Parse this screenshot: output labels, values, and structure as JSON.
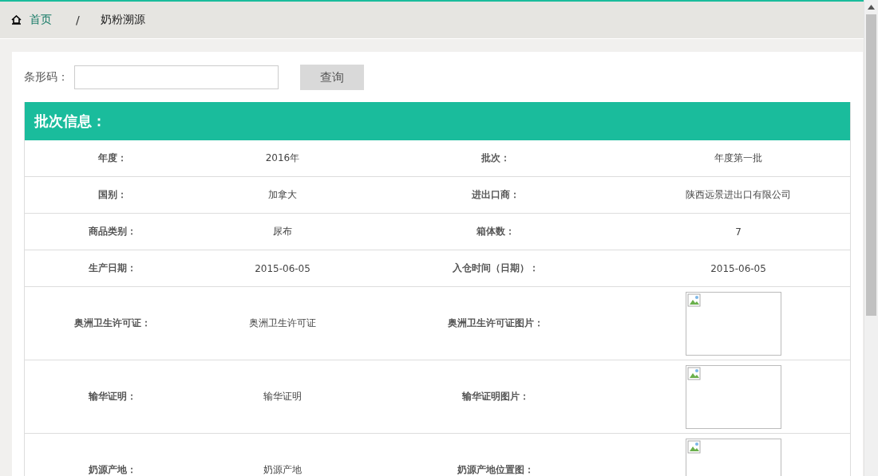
{
  "breadcrumb": {
    "home": "首页",
    "separator": "/",
    "current": "奶粉溯源"
  },
  "search": {
    "label": "条形码：",
    "button": "查询"
  },
  "panel": {
    "title": "批次信息：",
    "rows": [
      {
        "cells": [
          {
            "kind": "label",
            "text": "年度："
          },
          {
            "kind": "value",
            "text": "2016年"
          },
          {
            "kind": "label",
            "text": "批次："
          },
          {
            "kind": "value",
            "text": "年度第一批"
          }
        ]
      },
      {
        "cells": [
          {
            "kind": "label",
            "text": "国别："
          },
          {
            "kind": "value",
            "text": "加拿大"
          },
          {
            "kind": "label",
            "text": "进出口商："
          },
          {
            "kind": "value",
            "text": "陕西远景进出口有限公司"
          }
        ]
      },
      {
        "cells": [
          {
            "kind": "label",
            "text": "商品类别："
          },
          {
            "kind": "value",
            "text": "尿布"
          },
          {
            "kind": "label",
            "text": "箱体数："
          },
          {
            "kind": "value",
            "text": "7"
          }
        ]
      },
      {
        "cells": [
          {
            "kind": "label",
            "text": "生产日期："
          },
          {
            "kind": "value",
            "text": "2015-06-05"
          },
          {
            "kind": "label",
            "text": "入仓时间（日期）："
          },
          {
            "kind": "value",
            "text": "2015-06-05"
          }
        ]
      },
      {
        "cells": [
          {
            "kind": "label",
            "text": "奥洲卫生许可证："
          },
          {
            "kind": "value",
            "text": "奥洲卫生许可证"
          },
          {
            "kind": "label",
            "text": "奥洲卫生许可证图片："
          },
          {
            "kind": "image"
          }
        ]
      },
      {
        "cells": [
          {
            "kind": "label",
            "text": "输华证明："
          },
          {
            "kind": "value",
            "text": "输华证明"
          },
          {
            "kind": "label",
            "text": "输华证明图片："
          },
          {
            "kind": "image"
          }
        ]
      },
      {
        "cells": [
          {
            "kind": "label",
            "text": "奶源产地："
          },
          {
            "kind": "value",
            "text": "奶源产地"
          },
          {
            "kind": "label",
            "text": "奶源产地位置图："
          },
          {
            "kind": "image"
          }
        ]
      }
    ]
  }
}
